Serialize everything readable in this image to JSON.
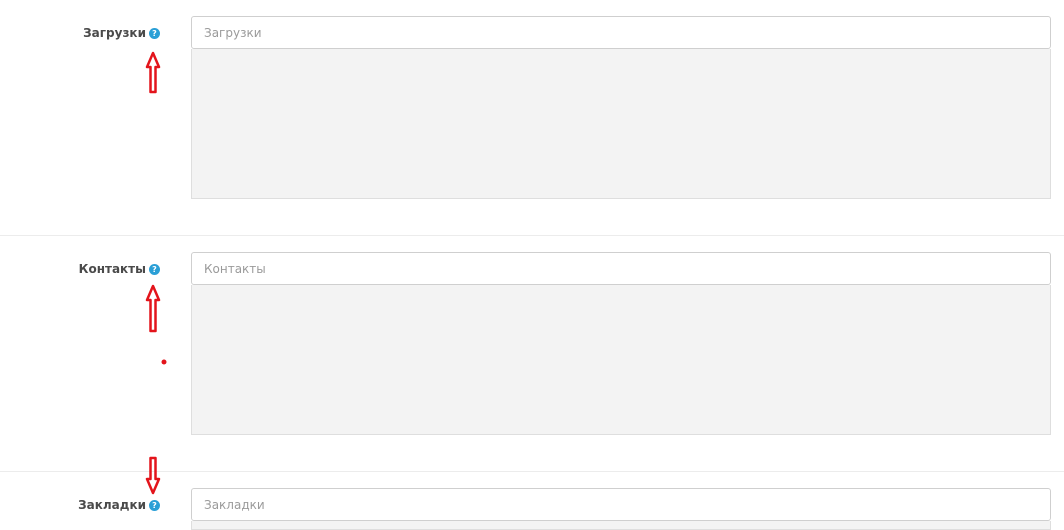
{
  "fields": [
    {
      "label": "Загрузки",
      "placeholder": "Загрузки",
      "help_icon": "question-circle-icon"
    },
    {
      "label": "Контакты",
      "placeholder": "Контакты",
      "help_icon": "question-circle-icon"
    },
    {
      "label": "Закладки",
      "placeholder": "Закладки",
      "help_icon": "question-circle-icon"
    }
  ],
  "colors": {
    "help_icon": "#2a9fd6",
    "annotation": "#e3141b",
    "result_box": "#f3f3f3"
  }
}
